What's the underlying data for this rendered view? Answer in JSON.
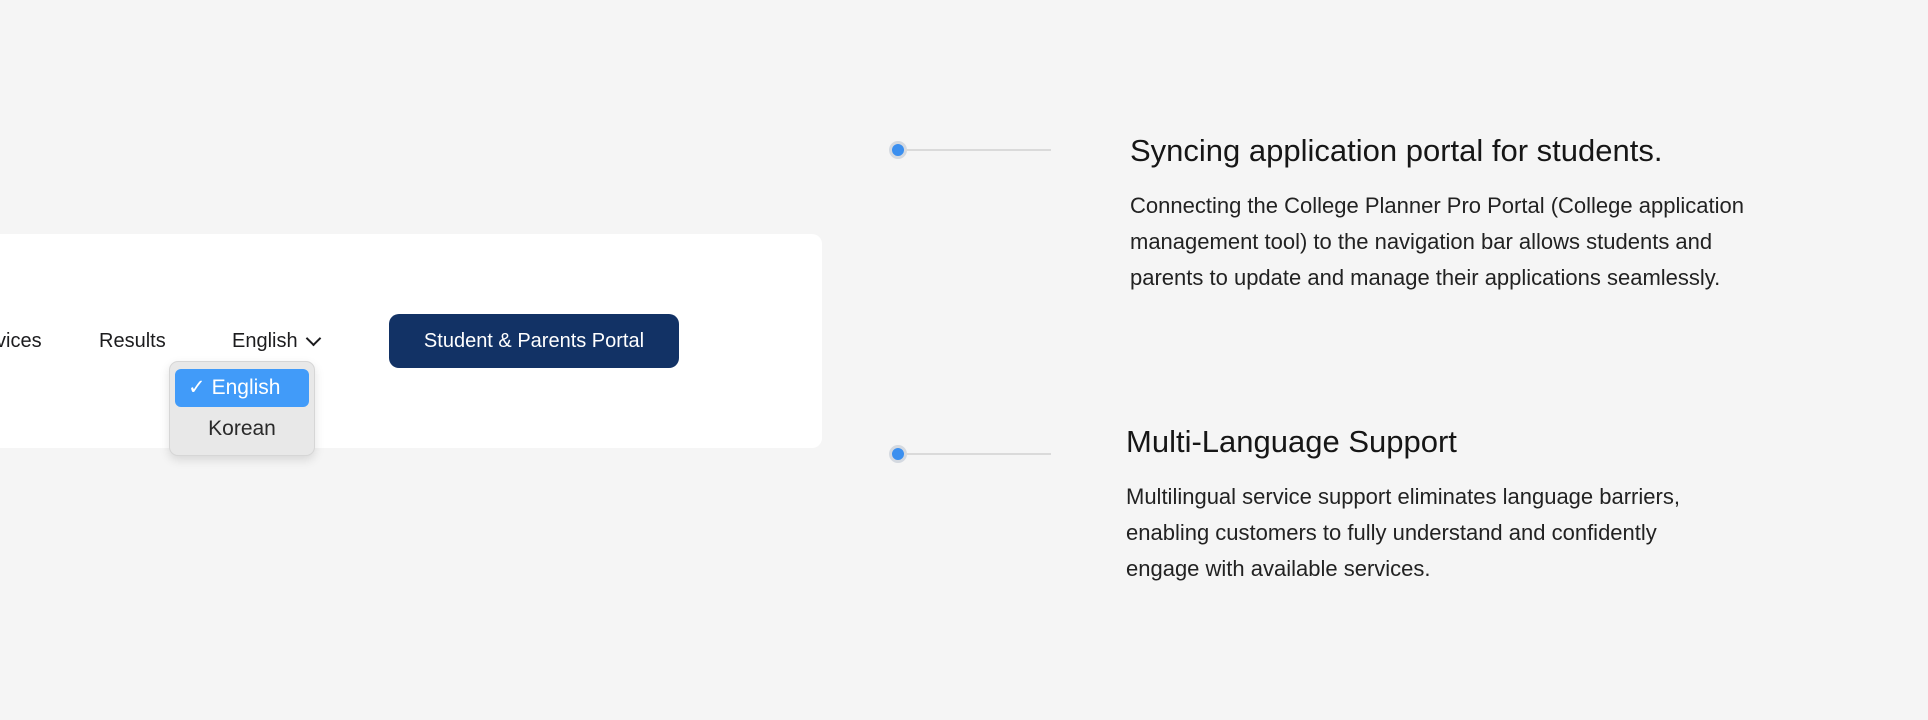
{
  "navigation": {
    "links": [
      {
        "label": "vices"
      },
      {
        "label": "Results"
      }
    ],
    "language_selector": {
      "current": "English"
    },
    "portal_button": {
      "label": "Student & Parents Portal"
    }
  },
  "language_dropdown": {
    "check_glyph": "✓",
    "options": [
      {
        "label": "English",
        "selected": true
      },
      {
        "label": "Korean",
        "selected": false
      }
    ]
  },
  "features": [
    {
      "title": "Syncing application portal for students.",
      "lines": [
        "Connecting the College Planner Pro Portal (College application",
        "management tool) to the navigation bar allows students and",
        "parents to update and manage their applications seamlessly."
      ]
    },
    {
      "title": "Multi-Language Support",
      "lines": [
        "Multilingual service support eliminates language barriers,",
        "enabling customers to fully understand and confidently",
        "engage with available services."
      ]
    }
  ],
  "colors": {
    "background": "#f5f5f5",
    "portal_button": "#123265",
    "dropdown_selected": "#419bf9",
    "timeline_dot": "#3b8fef"
  },
  "icons": {
    "dropdown_chevron": "chevron-down-icon",
    "selected_check": "checkmark-icon",
    "timeline_marker": "timeline-dot-icon"
  }
}
